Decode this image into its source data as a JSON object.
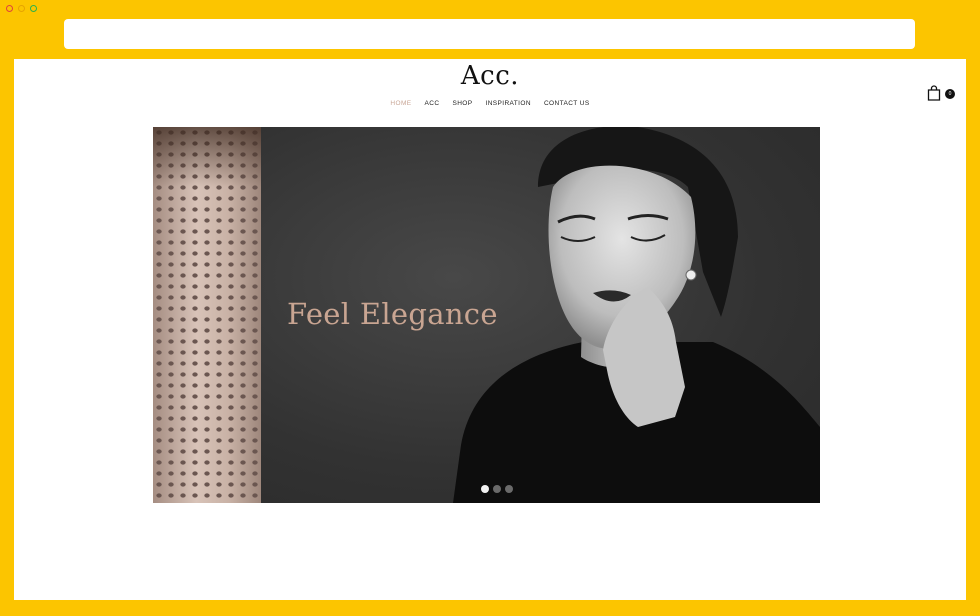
{
  "site": {
    "logo": "Acc.",
    "nav": [
      {
        "label": "HOME",
        "active": true
      },
      {
        "label": "ACC",
        "active": false
      },
      {
        "label": "SHOP",
        "active": false
      },
      {
        "label": "INSPIRATION",
        "active": false
      },
      {
        "label": "CONTACT US",
        "active": false
      }
    ],
    "cart": {
      "icon": "shopping-bag-icon",
      "count": "0"
    }
  },
  "hero": {
    "title": "Feel Elegance",
    "slides_total": 3,
    "active_slide": 1
  },
  "colors": {
    "frame": "#fcc500",
    "accent": "#c8a595",
    "hero_bg": "#3b3b3b"
  }
}
